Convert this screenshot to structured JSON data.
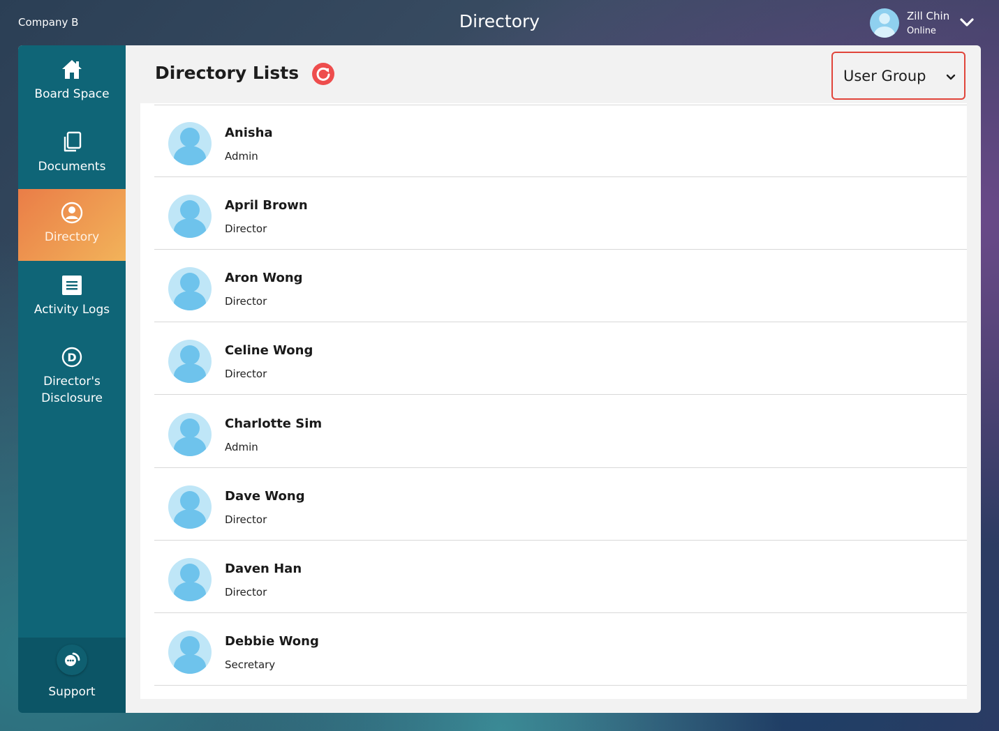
{
  "header": {
    "company": "Company B",
    "title": "Directory",
    "user": {
      "name": "Zill Chin",
      "status": "Online"
    }
  },
  "sidebar": {
    "items": [
      {
        "label": "Board Space",
        "icon": "home-icon",
        "active": false
      },
      {
        "label": "Documents",
        "icon": "documents-icon",
        "active": false
      },
      {
        "label": "Directory",
        "icon": "user-circle-icon",
        "active": true
      },
      {
        "label": "Activity Logs",
        "icon": "list-icon",
        "active": false
      },
      {
        "label": "Director's Disclosure",
        "icon": "d-circle-icon",
        "active": false
      }
    ],
    "support": {
      "label": "Support",
      "icon": "chat-icon"
    }
  },
  "main": {
    "title": "Directory Lists",
    "refresh_icon": "refresh-icon",
    "group_select": {
      "selected": "User Group"
    },
    "members": [
      {
        "name": "Anisha",
        "role": "Admin"
      },
      {
        "name": "April Brown",
        "role": "Director"
      },
      {
        "name": "Aron Wong",
        "role": "Director"
      },
      {
        "name": "Celine Wong",
        "role": "Director"
      },
      {
        "name": "Charlotte Sim",
        "role": "Admin"
      },
      {
        "name": "Dave Wong",
        "role": "Director"
      },
      {
        "name": "Daven Han",
        "role": "Director"
      },
      {
        "name": "Debbie Wong",
        "role": "Secretary"
      }
    ]
  },
  "colors": {
    "sidebar": "#0f6577",
    "active_start": "#ea7d47",
    "active_end": "#f2b35a",
    "accent_red": "#e0443a"
  }
}
